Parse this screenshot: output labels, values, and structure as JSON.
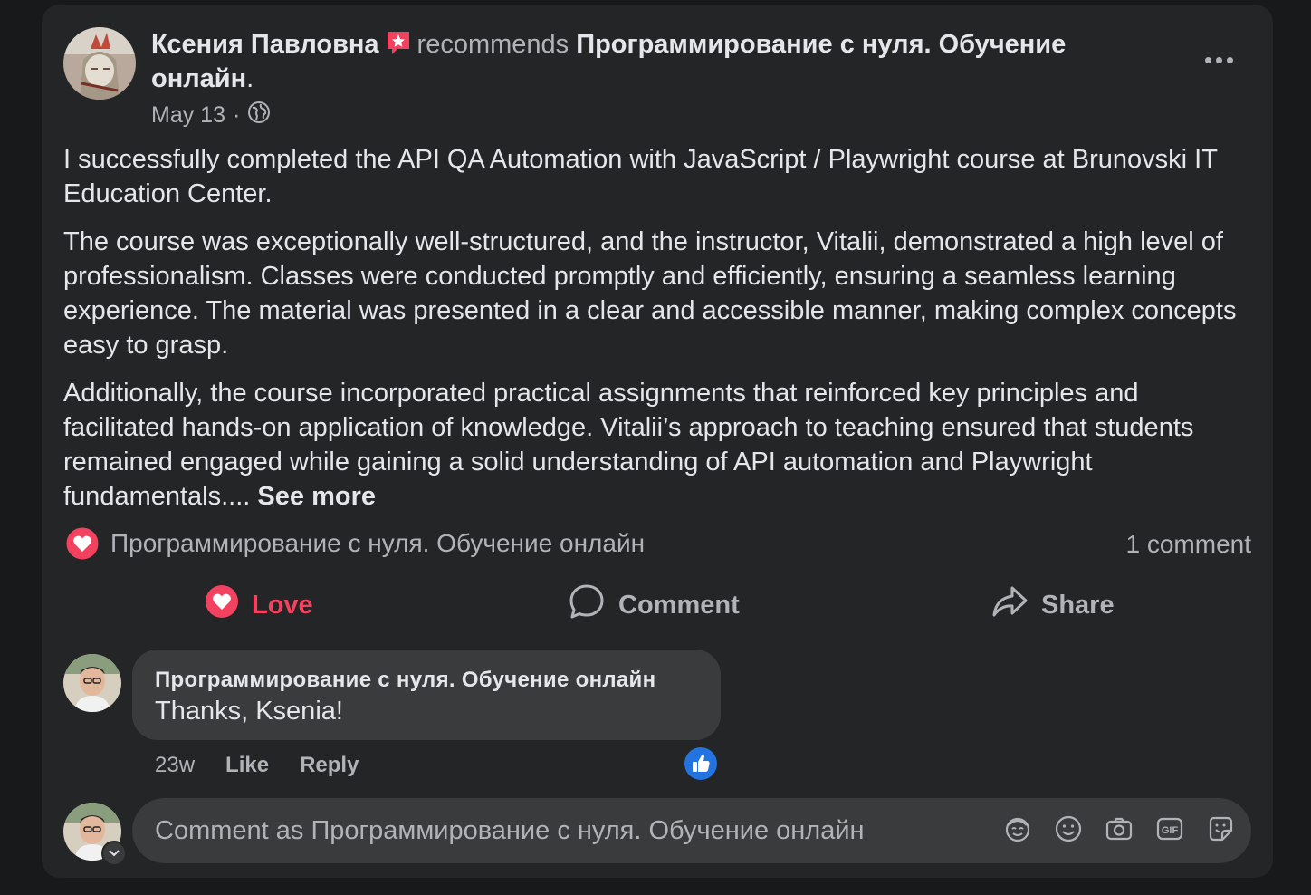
{
  "post": {
    "author": "Ксения Павловна",
    "verb": "recommends",
    "page": "Программирование с нуля. Обучение онлайн",
    "period": ".",
    "date": "May 13",
    "separator": "·",
    "privacy_icon": "globe-icon",
    "paragraphs": [
      "I successfully completed the API QA Automation with JavaScript / Playwright course at Brunovski IT Education Center.",
      "The course was exceptionally well-structured, and the instructor, Vitalii, demonstrated a high level of professionalism. Classes were conducted promptly and efficiently, ensuring a seamless learning experience. The material was presented in a clear and accessible manner, making complex concepts easy to grasp."
    ],
    "last_paragraph": "Additionally, the course incorporated practical assignments that reinforced key principles and facilitated hands-on application of knowledge. Vitalii’s approach to teaching ensured that students remained engaged while gaining a solid understanding of API automation and Playwright fundamentals.... ",
    "see_more": "See more"
  },
  "reactions": {
    "reactor": "Программирование с нуля. Обучение онлайн",
    "comment_count": "1 comment",
    "love_color": "#f3425f"
  },
  "actions": {
    "love": "Love",
    "comment": "Comment",
    "share": "Share"
  },
  "comment": {
    "author": "Программирование с нуля. Обучение онлайн",
    "text": "Thanks, Ksenia!",
    "age": "23w",
    "like": "Like",
    "reply": "Reply"
  },
  "composer": {
    "placeholder": "Comment as Программирование с нуля. Обучение онлайн",
    "icons": [
      "avatar-sticker-icon",
      "emoji-icon",
      "camera-icon",
      "gif-icon",
      "sticker-icon"
    ]
  },
  "colors": {
    "background": "#18191a",
    "card": "#242526",
    "bubble": "#3a3b3c",
    "accent_blue": "#2374e1"
  }
}
